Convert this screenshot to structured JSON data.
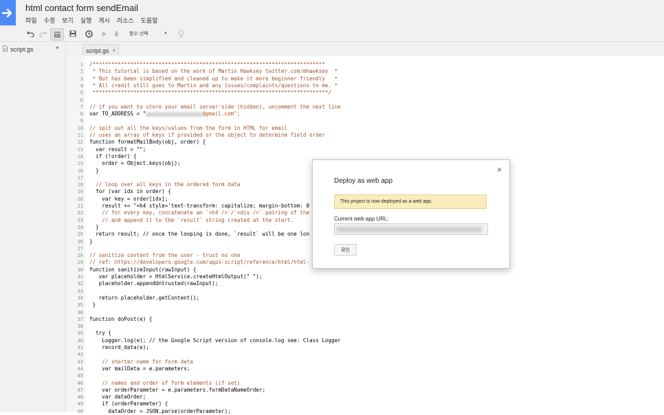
{
  "app": {
    "title": "html contact form sendEmail",
    "menu": [
      "파일",
      "수정",
      "보기",
      "실행",
      "게시",
      "리소스",
      "도움말"
    ]
  },
  "toolbar": {
    "function_select": "함수 선택"
  },
  "sidebar": {
    "file_name": "script.gs"
  },
  "tabs": [
    {
      "label": "script.gs",
      "close": "×"
    }
  ],
  "code": {
    "lines": [
      {
        "n": "1",
        "text": "/**************************************************************************",
        "cls": "c-com"
      },
      {
        "n": "2",
        "text": " * This tutorial is based on the work of Martin Hawksey twitter.com/mhawksey  *",
        "cls": "c-com"
      },
      {
        "n": "3",
        "text": " * But has been simplified and cleaned up to make it more beginner friendly   *",
        "cls": "c-com"
      },
      {
        "n": "4",
        "text": " * All credit still goes to Martin and any issues/complaints/questions to me. *",
        "cls": "c-com"
      },
      {
        "n": "5",
        "text": " ***************************************************************************/",
        "cls": "c-com"
      },
      {
        "n": "6",
        "text": "",
        "cls": ""
      },
      {
        "n": "7",
        "text": "// if you want to store your email server-side (hidden), uncomment the next line",
        "cls": "c-com"
      },
      {
        "n": "8",
        "text": "var TO_ADDRESS = \"",
        "cls": "",
        "blur": true,
        "after": "@gmail.com\";"
      },
      {
        "n": "9",
        "text": "",
        "cls": ""
      },
      {
        "n": "10",
        "text": "// spit out all the keys/values from the form in HTML for email",
        "cls": "c-com"
      },
      {
        "n": "11",
        "text": "// uses an array of keys if provided or the object to determine field order",
        "cls": "c-com"
      },
      {
        "n": "12",
        "text": "function formatMailBody(obj, order) {",
        "cls": ""
      },
      {
        "n": "13",
        "text": "  var result = \"\";",
        "cls": ""
      },
      {
        "n": "14",
        "text": "  if (!order) {",
        "cls": ""
      },
      {
        "n": "15",
        "text": "    order = Object.keys(obj);",
        "cls": ""
      },
      {
        "n": "16",
        "text": "  }",
        "cls": ""
      },
      {
        "n": "17",
        "text": "",
        "cls": ""
      },
      {
        "n": "18",
        "text": "  // loop over all keys in the ordered form data",
        "cls": "c-com"
      },
      {
        "n": "19",
        "text": "  for (var idx in order) {",
        "cls": ""
      },
      {
        "n": "20",
        "text": "    var key = order[idx];",
        "cls": ""
      },
      {
        "n": "21",
        "text": "    result += \"<h4 style='text-transform: capitalize; margin-bottom: 0",
        "cls": ""
      },
      {
        "n": "22",
        "text": "    // for every key, concatenate an `<h4 />`/`<div />` pairing of the",
        "cls": "c-com"
      },
      {
        "n": "23",
        "text": "    // and append it to the `result` string created at the start.",
        "cls": "c-com"
      },
      {
        "n": "24",
        "text": "  }",
        "cls": ""
      },
      {
        "n": "25",
        "text": "  return result; // once the looping is done, `result` will be one lon",
        "cls": ""
      },
      {
        "n": "26",
        "text": "}",
        "cls": ""
      },
      {
        "n": "27",
        "text": "",
        "cls": ""
      },
      {
        "n": "28",
        "text": "// sanitize content from the user - trust no one",
        "cls": "c-com"
      },
      {
        "n": "29",
        "text": "// ref: https://developers.google.com/apps-script/reference/html/html-",
        "cls": "c-com"
      },
      {
        "n": "30",
        "text": "function sanitizeInput(rawInput) {",
        "cls": ""
      },
      {
        "n": "31",
        "text": "   var placeholder = HtmlService.createHtmlOutput(\" \");",
        "cls": ""
      },
      {
        "n": "32",
        "text": "   placeholder.appendUntrusted(rawInput);",
        "cls": ""
      },
      {
        "n": "33",
        "text": "",
        "cls": ""
      },
      {
        "n": "34",
        "text": "   return placeholder.getContent();",
        "cls": ""
      },
      {
        "n": "35",
        "text": " }",
        "cls": ""
      },
      {
        "n": "36",
        "text": "",
        "cls": ""
      },
      {
        "n": "37",
        "text": "function doPost(e) {",
        "cls": ""
      },
      {
        "n": "38",
        "text": "",
        "cls": ""
      },
      {
        "n": "39",
        "text": "  try {",
        "cls": ""
      },
      {
        "n": "40",
        "text": "    Logger.log(e); // the Google Script version of console.log see: Class Logger",
        "cls": ""
      },
      {
        "n": "41",
        "text": "    record_data(e);",
        "cls": ""
      },
      {
        "n": "42",
        "text": "",
        "cls": ""
      },
      {
        "n": "43",
        "text": "    // shorter name for form data",
        "cls": "c-com"
      },
      {
        "n": "44",
        "text": "    var mailData = e.parameters;",
        "cls": ""
      },
      {
        "n": "45",
        "text": "",
        "cls": ""
      },
      {
        "n": "46",
        "text": "    // names and order of form elements (if set)",
        "cls": "c-com"
      },
      {
        "n": "47",
        "text": "    var orderParameter = e.parameters.formDataNameOrder;",
        "cls": ""
      },
      {
        "n": "48",
        "text": "    var dataOrder;",
        "cls": ""
      },
      {
        "n": "49",
        "text": "    if (orderParameter) {",
        "cls": ""
      },
      {
        "n": "50",
        "text": "      dataOrder = JSON.parse(orderParameter);",
        "cls": ""
      }
    ]
  },
  "dialog": {
    "title": "Deploy as web app",
    "close": "×",
    "notice": "This project is now deployed as a web app.",
    "url_label": "Current web app URL:",
    "ok": "확인"
  }
}
